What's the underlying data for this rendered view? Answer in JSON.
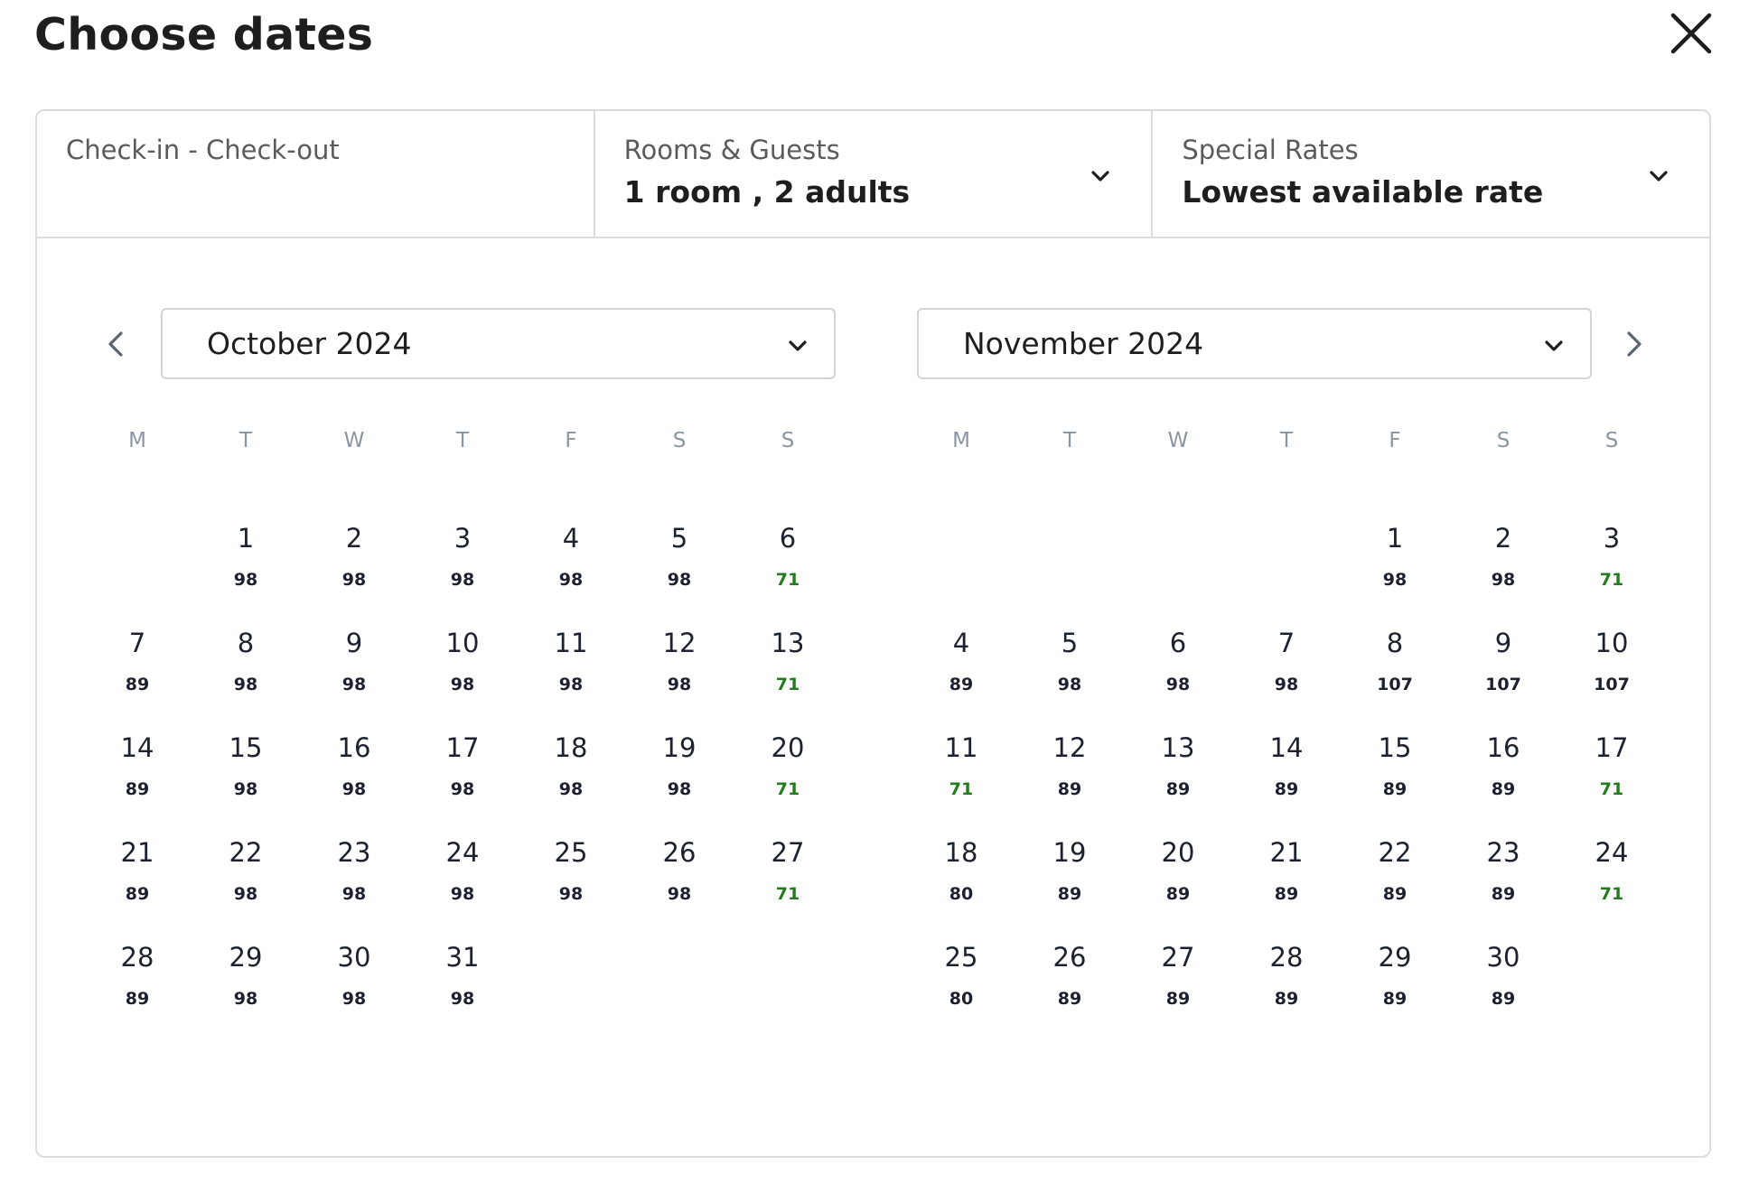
{
  "title": "Choose dates",
  "icons": {
    "close": "close-icon",
    "chevron_down": "chevron-down-icon",
    "prev": "chevron-left-icon",
    "next": "chevron-right-icon"
  },
  "colors": {
    "text": "#1e2230",
    "weekday": "#8b96a3",
    "low_price": "#237a1f",
    "border": "#dcdcdc"
  },
  "search_bar": {
    "dates": {
      "label": "Check-in - Check-out",
      "value": ""
    },
    "guests": {
      "label": "Rooms & Guests",
      "value": "1 room , 2 adults"
    },
    "rates": {
      "label": "Special Rates",
      "value": "Lowest available rate"
    }
  },
  "weekdays": [
    "M",
    "T",
    "W",
    "T",
    "F",
    "S",
    "S"
  ],
  "calendars": [
    {
      "month": "October 2024",
      "first_weekday_index": 1,
      "days": [
        {
          "d": "1",
          "p": "98",
          "low": false
        },
        {
          "d": "2",
          "p": "98",
          "low": false
        },
        {
          "d": "3",
          "p": "98",
          "low": false
        },
        {
          "d": "4",
          "p": "98",
          "low": false
        },
        {
          "d": "5",
          "p": "98",
          "low": false
        },
        {
          "d": "6",
          "p": "71",
          "low": true
        },
        {
          "d": "7",
          "p": "89",
          "low": false
        },
        {
          "d": "8",
          "p": "98",
          "low": false
        },
        {
          "d": "9",
          "p": "98",
          "low": false
        },
        {
          "d": "10",
          "p": "98",
          "low": false
        },
        {
          "d": "11",
          "p": "98",
          "low": false
        },
        {
          "d": "12",
          "p": "98",
          "low": false
        },
        {
          "d": "13",
          "p": "71",
          "low": true
        },
        {
          "d": "14",
          "p": "89",
          "low": false
        },
        {
          "d": "15",
          "p": "98",
          "low": false
        },
        {
          "d": "16",
          "p": "98",
          "low": false
        },
        {
          "d": "17",
          "p": "98",
          "low": false
        },
        {
          "d": "18",
          "p": "98",
          "low": false
        },
        {
          "d": "19",
          "p": "98",
          "low": false
        },
        {
          "d": "20",
          "p": "71",
          "low": true
        },
        {
          "d": "21",
          "p": "89",
          "low": false
        },
        {
          "d": "22",
          "p": "98",
          "low": false
        },
        {
          "d": "23",
          "p": "98",
          "low": false
        },
        {
          "d": "24",
          "p": "98",
          "low": false
        },
        {
          "d": "25",
          "p": "98",
          "low": false
        },
        {
          "d": "26",
          "p": "98",
          "low": false
        },
        {
          "d": "27",
          "p": "71",
          "low": true
        },
        {
          "d": "28",
          "p": "89",
          "low": false
        },
        {
          "d": "29",
          "p": "98",
          "low": false
        },
        {
          "d": "30",
          "p": "98",
          "low": false
        },
        {
          "d": "31",
          "p": "98",
          "low": false
        }
      ]
    },
    {
      "month": "November 2024",
      "first_weekday_index": 4,
      "days": [
        {
          "d": "1",
          "p": "98",
          "low": false
        },
        {
          "d": "2",
          "p": "98",
          "low": false
        },
        {
          "d": "3",
          "p": "71",
          "low": true
        },
        {
          "d": "4",
          "p": "89",
          "low": false
        },
        {
          "d": "5",
          "p": "98",
          "low": false
        },
        {
          "d": "6",
          "p": "98",
          "low": false
        },
        {
          "d": "7",
          "p": "98",
          "low": false
        },
        {
          "d": "8",
          "p": "107",
          "low": false
        },
        {
          "d": "9",
          "p": "107",
          "low": false
        },
        {
          "d": "10",
          "p": "107",
          "low": false
        },
        {
          "d": "11",
          "p": "71",
          "low": true
        },
        {
          "d": "12",
          "p": "89",
          "low": false
        },
        {
          "d": "13",
          "p": "89",
          "low": false
        },
        {
          "d": "14",
          "p": "89",
          "low": false
        },
        {
          "d": "15",
          "p": "89",
          "low": false
        },
        {
          "d": "16",
          "p": "89",
          "low": false
        },
        {
          "d": "17",
          "p": "71",
          "low": true
        },
        {
          "d": "18",
          "p": "80",
          "low": false
        },
        {
          "d": "19",
          "p": "89",
          "low": false
        },
        {
          "d": "20",
          "p": "89",
          "low": false
        },
        {
          "d": "21",
          "p": "89",
          "low": false
        },
        {
          "d": "22",
          "p": "89",
          "low": false
        },
        {
          "d": "23",
          "p": "89",
          "low": false
        },
        {
          "d": "24",
          "p": "71",
          "low": true
        },
        {
          "d": "25",
          "p": "80",
          "low": false
        },
        {
          "d": "26",
          "p": "89",
          "low": false
        },
        {
          "d": "27",
          "p": "89",
          "low": false
        },
        {
          "d": "28",
          "p": "89",
          "low": false
        },
        {
          "d": "29",
          "p": "89",
          "low": false
        },
        {
          "d": "30",
          "p": "89",
          "low": false
        }
      ]
    }
  ]
}
